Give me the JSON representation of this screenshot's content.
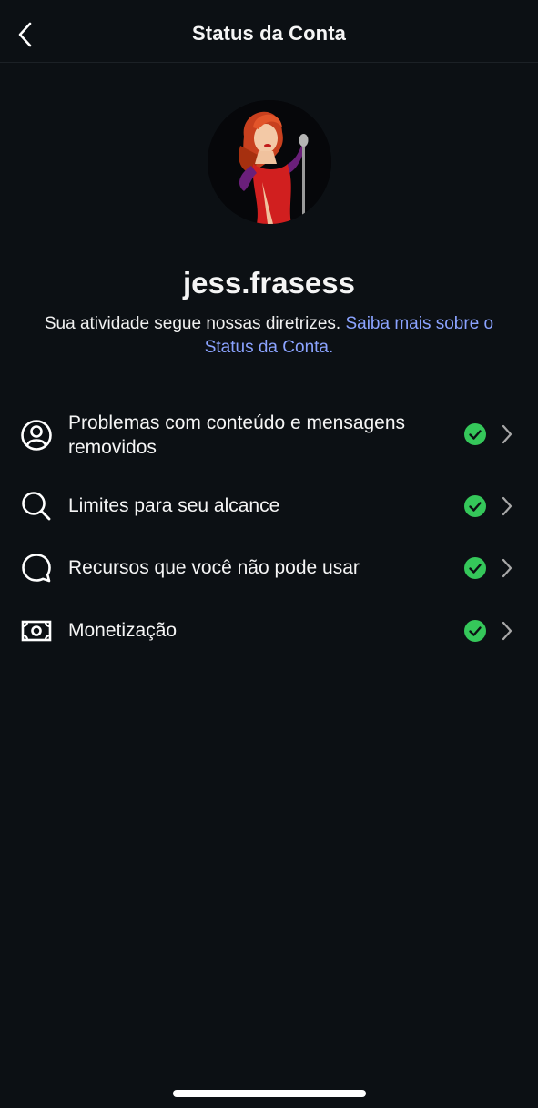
{
  "header": {
    "title": "Status da Conta"
  },
  "profile": {
    "username": "jess.frasess",
    "description": "Sua atividade segue nossas diretrizes.",
    "learn_more_link": "Saiba mais sobre o Status da Conta."
  },
  "items": [
    {
      "label": "Problemas com conteúdo e mensagens removidos",
      "icon": "user-circle-icon",
      "status": "ok"
    },
    {
      "label": "Limites para seu alcance",
      "icon": "search-icon",
      "status": "ok"
    },
    {
      "label": "Recursos que você não pode usar",
      "icon": "chat-bubble-icon",
      "status": "ok"
    },
    {
      "label": "Monetização",
      "icon": "money-icon",
      "status": "ok"
    }
  ],
  "colors": {
    "background": "#0c1014",
    "link": "#8ba3ff",
    "status_ok": "#35c75a",
    "text": "#f5f5f5"
  }
}
